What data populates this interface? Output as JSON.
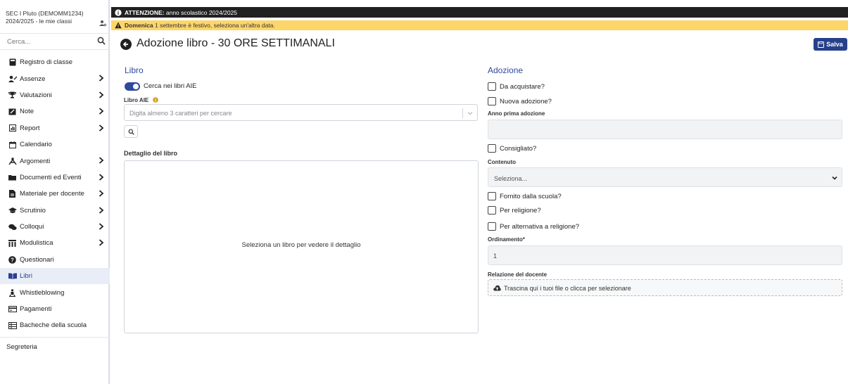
{
  "sidebar": {
    "school": "SEC I Pluto (DEMOMM1234)",
    "year": "2024/2025 - le mie classi",
    "search_placeholder": "Cerca...",
    "items": [
      {
        "label": "Registro di classe",
        "icon": "book-icon",
        "chevron": false
      },
      {
        "label": "Assenze",
        "icon": "user-absence-icon",
        "chevron": true
      },
      {
        "label": "Valutazioni",
        "icon": "trophy-icon",
        "chevron": true
      },
      {
        "label": "Note",
        "icon": "note-icon",
        "chevron": true
      },
      {
        "label": "Report",
        "icon": "report-icon",
        "chevron": true
      },
      {
        "label": "Calendario",
        "icon": "calendar-icon",
        "chevron": false
      },
      {
        "label": "Argomenti",
        "icon": "topics-icon",
        "chevron": true
      },
      {
        "label": "Documenti ed Eventi",
        "icon": "folder-icon",
        "chevron": true
      },
      {
        "label": "Materiale per docente",
        "icon": "file-icon",
        "chevron": true
      },
      {
        "label": "Scrutinio",
        "icon": "graduation-cap-icon",
        "chevron": true
      },
      {
        "label": "Colloqui",
        "icon": "comments-icon",
        "chevron": true
      },
      {
        "label": "Modulistica",
        "icon": "forms-icon",
        "chevron": true
      },
      {
        "label": "Questionari",
        "icon": "question-icon",
        "chevron": false
      },
      {
        "label": "Libri",
        "icon": "open-book-icon",
        "chevron": false,
        "active": true
      },
      {
        "label": "Whistleblowing",
        "icon": "whistleblowing-icon",
        "chevron": false
      },
      {
        "label": "Pagamenti",
        "icon": "payment-card-icon",
        "chevron": false
      },
      {
        "label": "Bacheche della scuola",
        "icon": "board-icon",
        "chevron": false
      }
    ],
    "footer_item": "Segreteria"
  },
  "banners": {
    "attention_bold": "ATTENZIONE:",
    "attention_text": " anno scolastico 2024/2025",
    "warning_bold": "Domenica",
    "warning_text": " 1 settembre è festivo, seleziona un'altra data."
  },
  "header": {
    "title": "Adozione libro - 30 ORE SETTIMANALI",
    "save_label": "Salva"
  },
  "libro": {
    "section_title": "Libro",
    "toggle_label": "Cerca nei libri AIE",
    "toggle_on": true,
    "aie_label": "Libro AIE",
    "aie_placeholder": "Digita almeno 3 caratteri per cercare",
    "detail_title": "Dettaglio del libro",
    "detail_empty": "Seleziona un libro per vedere il dettaglio"
  },
  "adozione": {
    "section_title": "Adozione",
    "da_acquistare": "Da acquistare?",
    "nuova_adozione": "Nuova adozione?",
    "anno_prima_label": "Anno prima adozione",
    "anno_prima_value": "",
    "consigliato": "Consigliato?",
    "contenuto_label": "Contenuto",
    "contenuto_value": "Seleziona...",
    "fornito": "Fornito dalla scuola?",
    "religione": "Per religione?",
    "alternativa": "Per alternativa a religione?",
    "ordinamento_label": "Ordinamento*",
    "ordinamento_value": "1",
    "relazione_label": "Relazione del docente",
    "relazione_text": "Trascina qui i tuoi file o clicca per selezionare"
  },
  "colors": {
    "primary": "#2d4a9c",
    "save_button": "#26408b",
    "warning": "#fdd66a",
    "dark_banner": "#212121",
    "active_menu_bg": "#e9edf7"
  }
}
